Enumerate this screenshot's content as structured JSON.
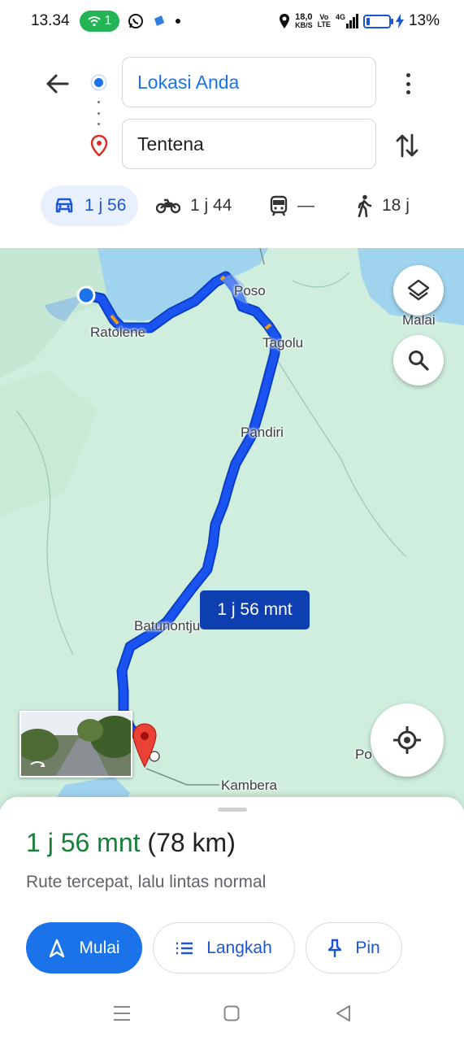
{
  "status": {
    "time": "13.34",
    "hotspot_count": "1",
    "net_speed_top": "18,0",
    "net_speed_unit": "KB/S",
    "volte_top": "Vo",
    "volte_bottom": "LTE",
    "net_type": "4G",
    "battery_percent": "13%",
    "battery_level": 0.13,
    "icons": [
      "wifi-hotspot-icon",
      "whatsapp-icon",
      "app-icon",
      "notification-dot-icon",
      "location-icon",
      "signal-icon",
      "battery-icon",
      "charging-icon"
    ]
  },
  "directions": {
    "origin": "Lokasi Anda",
    "destination": "Tentena"
  },
  "modes": [
    {
      "name": "car",
      "label": "1 j 56",
      "active": true
    },
    {
      "name": "motorcycle",
      "label": "1 j 44"
    },
    {
      "name": "transit",
      "label": "—"
    },
    {
      "name": "walk",
      "label": "18 j"
    }
  ],
  "map": {
    "places": [
      "Poso",
      "Malai",
      "Ratolene",
      "Tagolu",
      "Pandiri",
      "Batunontju",
      "Kambera",
      "Po"
    ],
    "route_callout": "1 j 56 mnt",
    "route_color": "#1a53f0"
  },
  "route_summary": {
    "duration": "1 j 56 mnt",
    "distance": "(78 km)",
    "description": "Rute tercepat, lalu lintas normal"
  },
  "actions": {
    "start": "Mulai",
    "steps": "Langkah",
    "pin": "Pin"
  },
  "colors": {
    "accent": "#1a73e8",
    "duration_green": "#188038",
    "land": "#cfeedd",
    "water": "#9fd3ee"
  }
}
